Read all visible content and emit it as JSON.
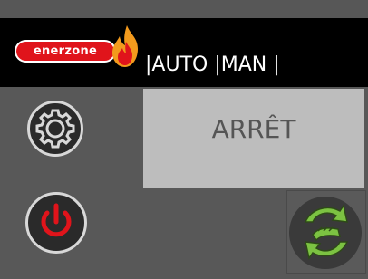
{
  "brand": {
    "logo_text": "enerzone",
    "logo_color": "#e0141b",
    "flame_colors": [
      "#f39a1d",
      "#e0141b"
    ]
  },
  "header": {
    "mode_bar_text": "|AUTO |MAN |"
  },
  "status": {
    "text": "ARRÊT",
    "panel_color": "#bdbdbd"
  },
  "controls": {
    "settings_icon": "gear-icon",
    "power_icon": "power-icon",
    "power_color": "#e0141b",
    "mode_switch_icon": "recycle-arrows-icon",
    "mode_switch_color": "#7cc242"
  }
}
